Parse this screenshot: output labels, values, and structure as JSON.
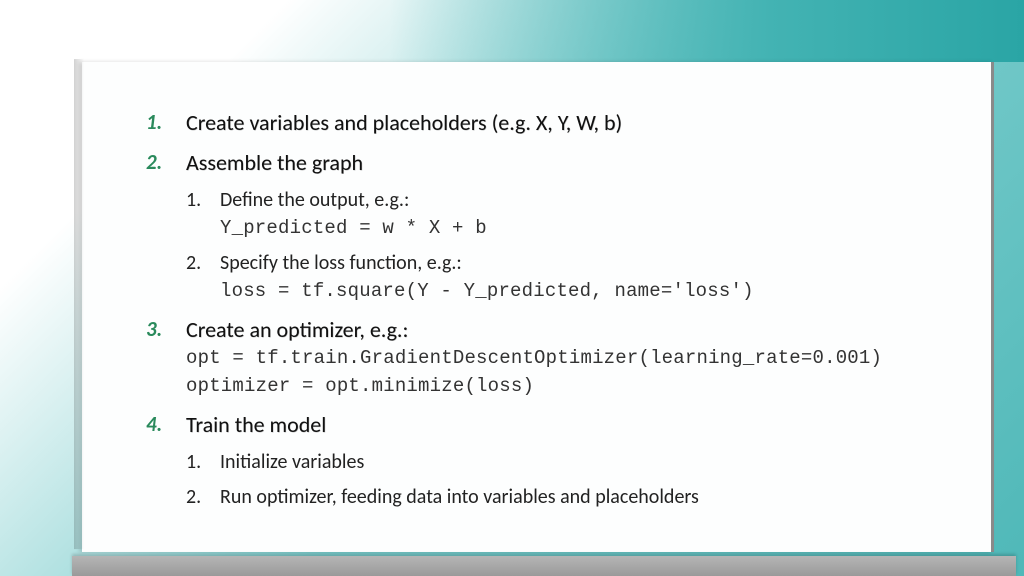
{
  "items": [
    {
      "title": "Create variables and placeholders (e.g. X, Y, W, b)"
    },
    {
      "title": "Assemble the graph",
      "sub": [
        {
          "text": "Define the output, e.g.:",
          "code": "Y_predicted = w * X + b"
        },
        {
          "text": "Specify the loss function, e.g.:",
          "code": "loss = tf.square(Y - Y_predicted, name='loss')"
        }
      ]
    },
    {
      "title": "Create an optimizer, e.g.:",
      "code1": "opt = tf.train.GradientDescentOptimizer(learning_rate=0.001)",
      "code2": "optimizer = opt.minimize(loss)"
    },
    {
      "title": "Train the model",
      "sub": [
        {
          "text": "Initialize variables"
        },
        {
          "text": "Run optimizer, feeding data into variables and placeholders"
        }
      ]
    }
  ]
}
